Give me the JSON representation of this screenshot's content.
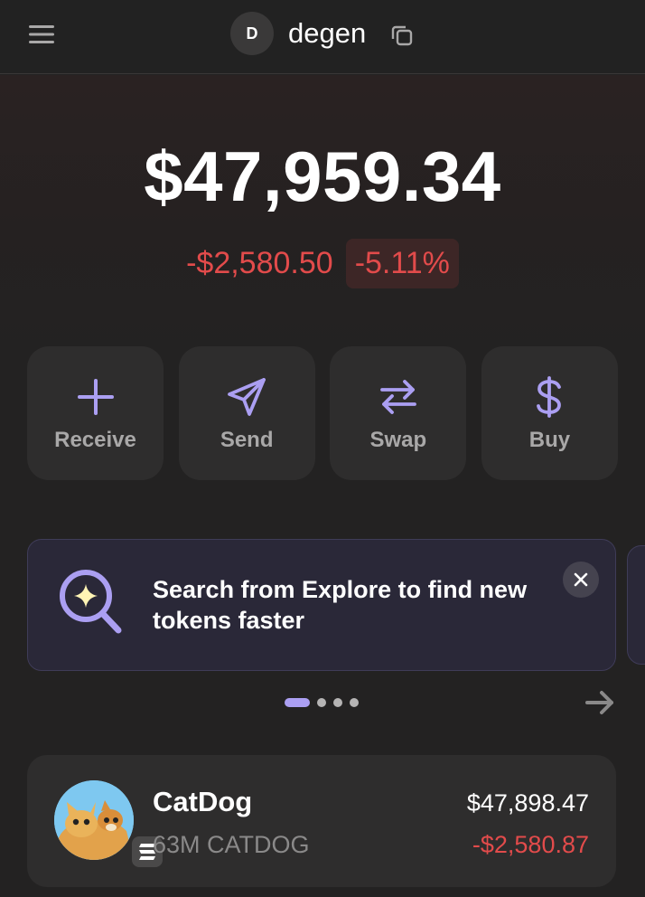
{
  "header": {
    "account_initial": "D",
    "account_name": "degen",
    "menu_icon": "hamburger-menu-icon",
    "copy_icon": "copy-icon"
  },
  "balance": {
    "total": "$47,959.34",
    "change_abs": "-$2,580.50",
    "change_pct": "-5.11%"
  },
  "actions": [
    {
      "label": "Receive",
      "icon": "plus-icon"
    },
    {
      "label": "Send",
      "icon": "send-icon"
    },
    {
      "label": "Swap",
      "icon": "swap-icon"
    },
    {
      "label": "Buy",
      "icon": "dollar-icon"
    }
  ],
  "promo": {
    "text": "Search from Explore to find new tokens faster",
    "icon": "search-sparkle-icon",
    "close_icon": "close-icon"
  },
  "carousel": {
    "page_count": 4,
    "active_page": 1,
    "next_icon": "arrow-right-icon"
  },
  "tokens": [
    {
      "name": "CatDog",
      "amount": "63M CATDOG",
      "value": "$47,898.47",
      "change": "-$2,580.87",
      "chain_icon": "solana-icon"
    }
  ],
  "colors": {
    "background": "#232222",
    "accent": "#ab9ff2",
    "negative": "#e24b4b",
    "card": "#2e2d2d"
  }
}
